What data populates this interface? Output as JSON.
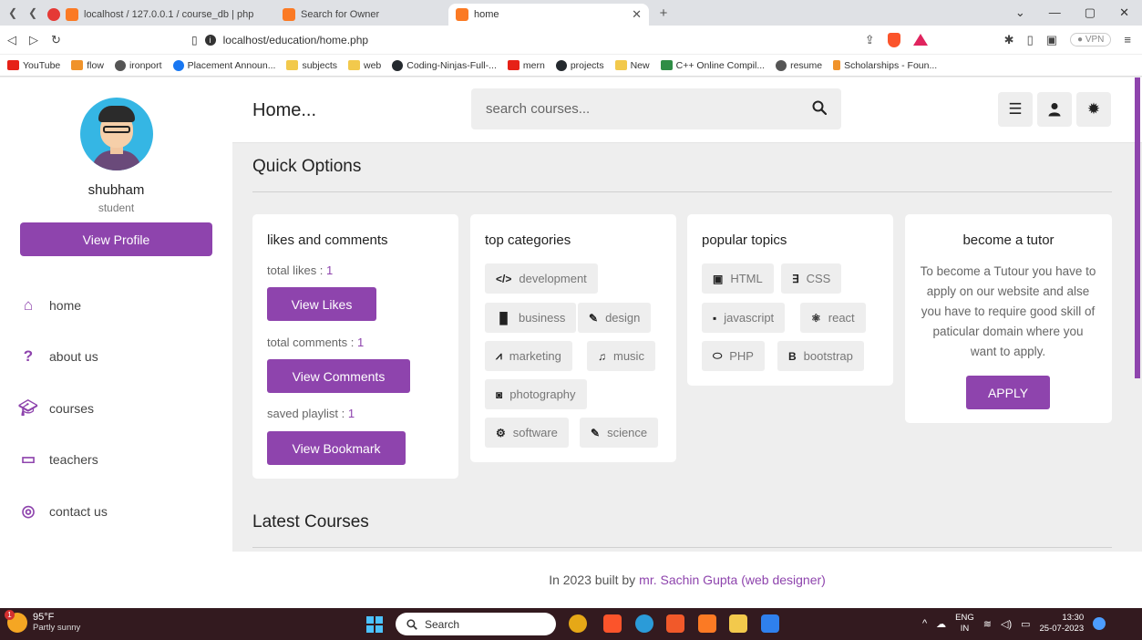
{
  "browser": {
    "tabs": [
      {
        "label": "localhost / 127.0.0.1 / course_db | php"
      },
      {
        "label": "Search for Owner"
      },
      {
        "label": "home"
      }
    ],
    "url": "localhost/education/home.php",
    "vpn_label": "● VPN",
    "bookmarks": [
      "YouTube",
      "flow",
      "ironport",
      "Placement Announ...",
      "subjects",
      "web",
      "Coding-Ninjas-Full-...",
      "mern",
      "projects",
      "New",
      "C++ Online Compil...",
      "resume",
      "Scholarships - Foun..."
    ]
  },
  "sidebar": {
    "name": "shubham",
    "role": "student",
    "profile_button": "View Profile",
    "nav": [
      {
        "label": "home",
        "icon": "home-icon"
      },
      {
        "label": "about us",
        "icon": "question-icon"
      },
      {
        "label": "courses",
        "icon": "graduation-cap-icon"
      },
      {
        "label": "teachers",
        "icon": "chalkboard-teacher-icon"
      },
      {
        "label": "contact us",
        "icon": "headset-icon"
      }
    ]
  },
  "header": {
    "logo": "Home...",
    "search_placeholder": "search courses..."
  },
  "quick_options": {
    "title": "Quick Options",
    "likes_card": {
      "title": "likes and comments",
      "total_likes_label": "total likes : ",
      "total_likes": "1",
      "view_likes": "View Likes",
      "total_comments_label": "total comments : ",
      "total_comments": "1",
      "view_comments": "View Comments",
      "saved_playlist_label": "saved playlist : ",
      "saved_playlist": "1",
      "view_bookmark": "View Bookmark"
    },
    "categories_card": {
      "title": "top categories",
      "items": [
        "development",
        "business",
        "design",
        "marketing",
        "music",
        "photography",
        "software",
        "science"
      ]
    },
    "topics_card": {
      "title": "popular topics",
      "items": [
        "HTML",
        "CSS",
        "javascript",
        "react",
        "PHP",
        "bootstrap"
      ]
    },
    "tutor_card": {
      "title": "become a tutor",
      "text": "To become a Tutour you have to apply on our website and alse you have to require good skill of paticular domain where you want to apply.",
      "apply": "APPLY"
    }
  },
  "latest": {
    "title": "Latest Courses"
  },
  "footer": {
    "text": "In 2023 built by",
    "author": "mr. Sachin Gupta (web designer)"
  },
  "taskbar": {
    "temp": "95°F",
    "weather": "Partly sunny",
    "weather_badge": "1",
    "search": "Search",
    "lang_top": "ENG",
    "lang_bottom": "IN",
    "time": "13:30",
    "date": "25-07-2023"
  },
  "colors": {
    "accent": "#8e44ad",
    "page_bg": "#eeeeee"
  }
}
